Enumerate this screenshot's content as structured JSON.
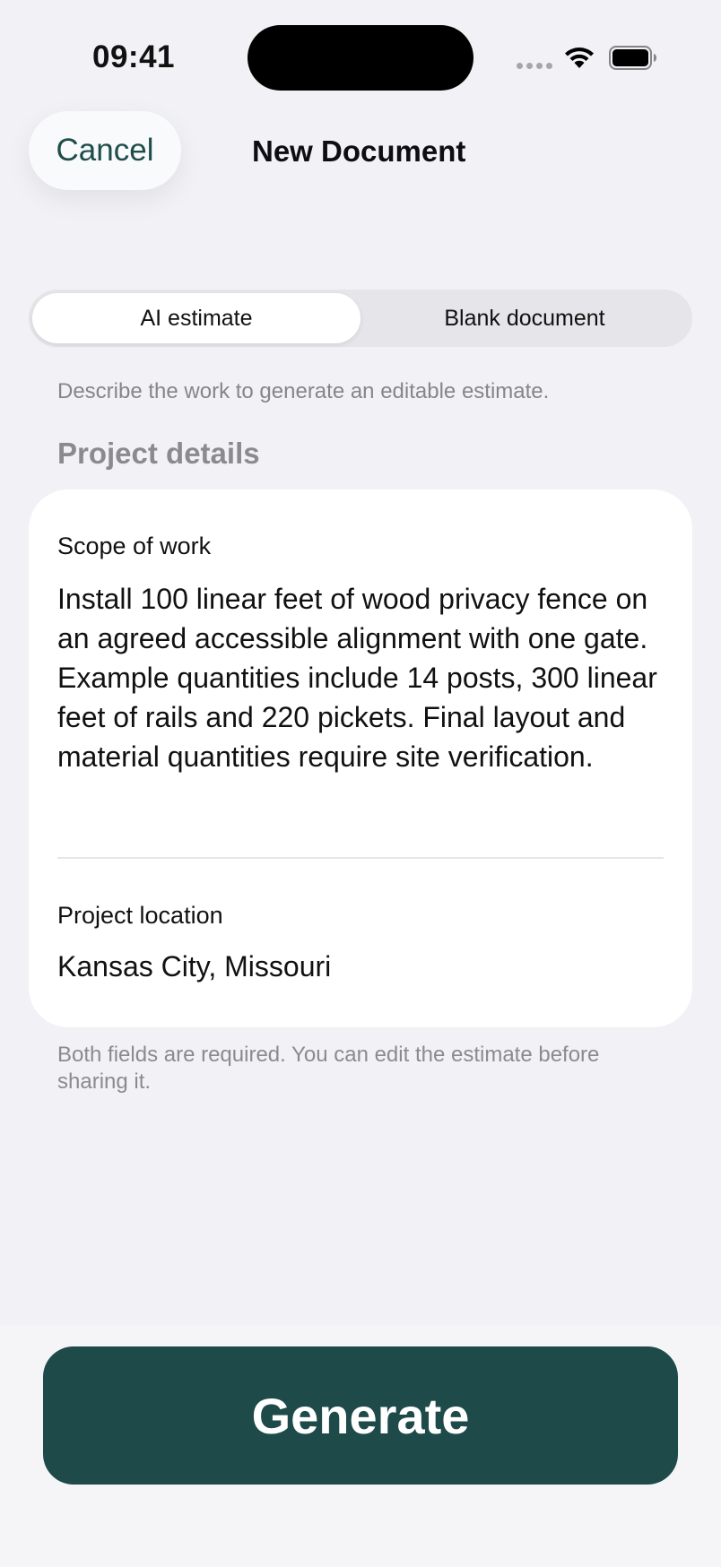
{
  "status_bar": {
    "time": "09:41"
  },
  "nav": {
    "cancel_label": "Cancel",
    "title": "New Document"
  },
  "segments": {
    "ai_estimate": "AI estimate",
    "blank_document": "Blank document",
    "selected": "AI estimate"
  },
  "hint": "Describe the work to generate an editable estimate.",
  "section_title": "Project details",
  "form": {
    "scope_label": "Scope of work",
    "scope_value": "Install 100 linear feet of wood privacy fence on an agreed accessible alignment with one gate. Example quantities include 14 posts, 300 linear feet of rails and 220 pickets. Final layout and material quantities require site verification.",
    "location_label": "Project location",
    "location_value": "Kansas City, Missouri"
  },
  "footnote": "Both fields are required. You can edit the estimate before sharing it.",
  "generate_label": "Generate",
  "colors": {
    "accent": "#1E4A4A",
    "background": "#F1F1F6",
    "card": "#FFFFFF"
  },
  "icons": {
    "wifi": "wifi-icon",
    "battery": "battery-icon",
    "signal": "signal-icon"
  }
}
